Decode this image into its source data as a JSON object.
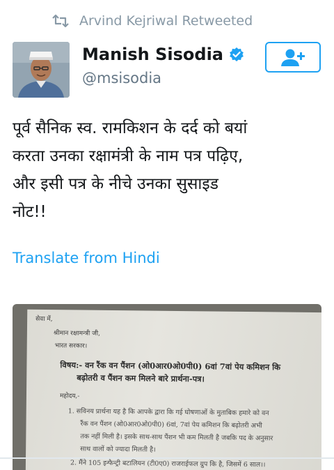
{
  "retweet_header": {
    "text": "Arvind Kejriwal Retweeted",
    "icon": "retweet-icon"
  },
  "user": {
    "name": "Manish Sisodia",
    "handle": "@msisodia",
    "verified_icon": "verified-badge-icon",
    "avatar_icon": "avatar"
  },
  "follow_button": {
    "icon": "add-user-icon",
    "color": "#1da1f2"
  },
  "tweet": {
    "text": "पूर्व सैनिक स्व. रामकिशन के दर्द को बयां\nकरता उनका रक्षामंत्री के नाम पत्र पढ़िए,\nऔर इसी पत्र के नीचे उनका सुसाइड\nनोट!!",
    "translate_label": "Translate from Hindi"
  },
  "media": {
    "letter": {
      "salutation": "सेवा में,",
      "addressee": "श्रीमान रक्षामन्त्री जी,",
      "government": "भारत सरकार।",
      "subject_line1": "विषय:- वन रैंक वन पैंशन (ओ0आर0ओ0पी0) 6वां 7वां पेय कमिशन कि",
      "subject_line2": "बढ़ोतरी व पैंशन कम मिलने बारे प्रार्थना-पत्र।",
      "greeting": "महोदय,-",
      "para_line1": "1.  सविनय प्रार्थना यह है कि आपके द्वारा कि गई घोषणाओं के मुताबिक हमारे को वन",
      "para_line2": "रैंक वन पैंशन (ओ0आर0ओ0पी0) 6वां, 7वां पेय कमिशन कि बढ़ोतरी अभी",
      "para_line3": "तक नहीं मिली है। इसके साथ-साथ पैंशन भी कम मिलती है जबकि पद के अनुसार",
      "para_line4": "साथ वालों को ज्यादा मिलती है।",
      "para_line5": "2.  मैंने 105 इन्फैन्ट्री बटालियन (टी0ए0) राजराईफल ग्रुप कि है, जिसमें 6 साल।।"
    }
  },
  "colors": {
    "accent": "#1da1f2",
    "muted": "#8899a6",
    "text": "#14171a"
  }
}
